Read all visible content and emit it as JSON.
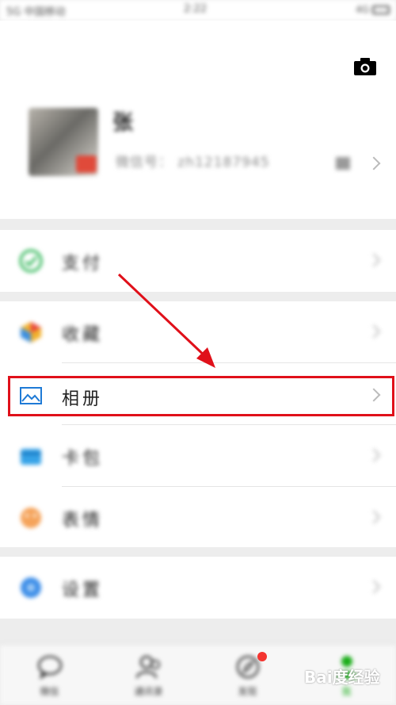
{
  "status_bar": {
    "carrier": "5G 中国移动",
    "time": "2:22",
    "signal_text": "4G"
  },
  "profile": {
    "name": "张",
    "wechat_id": "微信号： zh12187945"
  },
  "menu": {
    "pay": "支付",
    "favorites": "收藏",
    "album": "相册",
    "cards": "卡包",
    "stickers": "表情",
    "settings": "设置"
  },
  "tabs": [
    {
      "label": "微信"
    },
    {
      "label": "通讯录"
    },
    {
      "label": "发现"
    },
    {
      "label": "我"
    }
  ],
  "watermark": "Bai度经验",
  "colors": {
    "accent_green": "#1aad19",
    "highlight_red": "#e0101a",
    "album_blue": "#1e7ad6"
  }
}
